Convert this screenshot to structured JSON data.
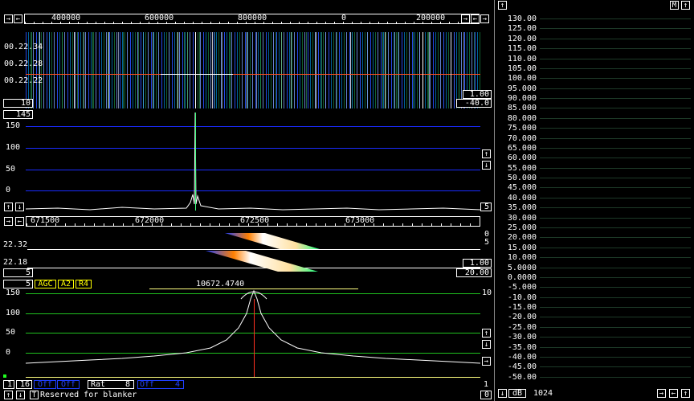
{
  "spectrum_axis": {
    "labels": [
      "400000",
      "600000",
      "800000",
      "0",
      "200000"
    ]
  },
  "waterfall": {
    "times": [
      "00.22.34",
      "00.22.28",
      "00.22.22"
    ],
    "left_box": "10",
    "gain_box": "1.00",
    "offset_box": "-40.0"
  },
  "wide_graph": {
    "top_box": "145",
    "yticks": [
      "150",
      "100",
      "50",
      "0"
    ],
    "right_box": "5"
  },
  "baseband_axis": {
    "labels": [
      "671500",
      "672000",
      "672500",
      "673000"
    ]
  },
  "baseband_waterfall": {
    "times": [
      "22.32",
      "22.18"
    ],
    "right_top": [
      "0",
      "5"
    ],
    "gain_box": "1.00",
    "offset_box": "20.00",
    "left_box": "5"
  },
  "baseband_graph": {
    "left_box": "5",
    "agc": "AGC",
    "a2": "A2",
    "r4": "R4",
    "frequency": "10672.4740",
    "yticks": [
      "150",
      "100",
      "50",
      "0"
    ],
    "right_top": "10",
    "right_bottom": "1"
  },
  "status_bar": {
    "box1": "1",
    "box2": "16",
    "off1": "Off",
    "off2": "Off",
    "rat_label": "Rat",
    "rat_value": "8",
    "off3": "Off",
    "off3_value": "4",
    "t_button": "T",
    "message": "Reserved for blanker",
    "right_box": "0"
  },
  "side_panel": {
    "m_button": "M",
    "scale": [
      "130.00",
      "125.00",
      "120.00",
      "115.00",
      "110.00",
      "105.00",
      "100.00",
      "95.000",
      "90.000",
      "85.000",
      "80.000",
      "75.000",
      "70.000",
      "65.000",
      "60.000",
      "55.000",
      "50.000",
      "45.000",
      "40.000",
      "35.000",
      "30.000",
      "25.000",
      "20.000",
      "15.000",
      "10.000",
      "5.0000",
      "0.0000",
      "-5.000",
      "-10.00",
      "-15.00",
      "-20.00",
      "-25.00",
      "-30.00",
      "-35.00",
      "-40.00",
      "-45.00",
      "-50.00"
    ],
    "db_label": "dB",
    "fft_size": "1024"
  },
  "colors": {
    "grid_blue": "#1a2cff",
    "grid_green": "#20c020",
    "signal_yellow": "#ffff40",
    "marker_red": "#ff3020"
  }
}
